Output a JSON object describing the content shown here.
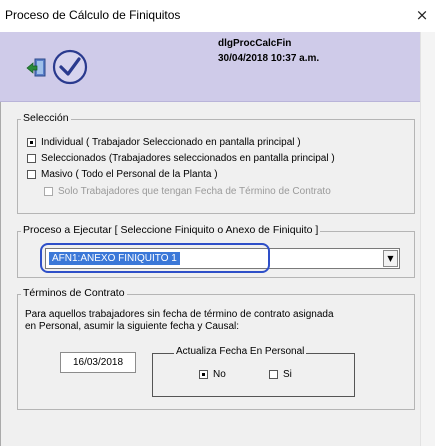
{
  "window": {
    "title": "Proceso de Cálculo de Finiquitos",
    "close_label": "×"
  },
  "header": {
    "dialog_name": "dlgProcCalcFin",
    "datetime": "30/04/2018 10:37 a.m.",
    "exit_icon": "exit-door-icon",
    "ok_icon": "checkmark-circle-icon"
  },
  "seleccion": {
    "legend": "Selección",
    "options": [
      {
        "label": "Individual ( Trabajador Seleccionado en pantalla principal )",
        "checked": true
      },
      {
        "label": "Seleccionados (Trabajadores seleccionados en pantalla principal )",
        "checked": false
      },
      {
        "label": "Masivo ( Todo el Personal de la Planta )",
        "checked": false
      }
    ],
    "sub_option": {
      "label": "Solo Trabajadores que tengan Fecha de Término de Contrato",
      "checked": false,
      "enabled": false
    }
  },
  "proceso": {
    "legend": "Proceso a Ejecutar [ Seleccione Finiquito o Anexo de Finiquito ]",
    "selected_value": "AFN1:ANEXO FINIQUITO 1"
  },
  "terminos": {
    "legend": "Términos de Contrato",
    "description_line1": "Para aquellos trabajadores sin fecha de término de contrato asignada",
    "description_line2": "en Personal, asumir la siguiente fecha y Causal:",
    "date_value": "16/03/2018",
    "actualiza": {
      "legend": "Actualiza Fecha En Personal",
      "no_label": "No",
      "si_label": "Si",
      "selected": "No"
    }
  },
  "colors": {
    "header_band": "#cfcbe9",
    "selection_highlight": "#3b78d8",
    "annotation_ring": "#2e4fc8"
  }
}
